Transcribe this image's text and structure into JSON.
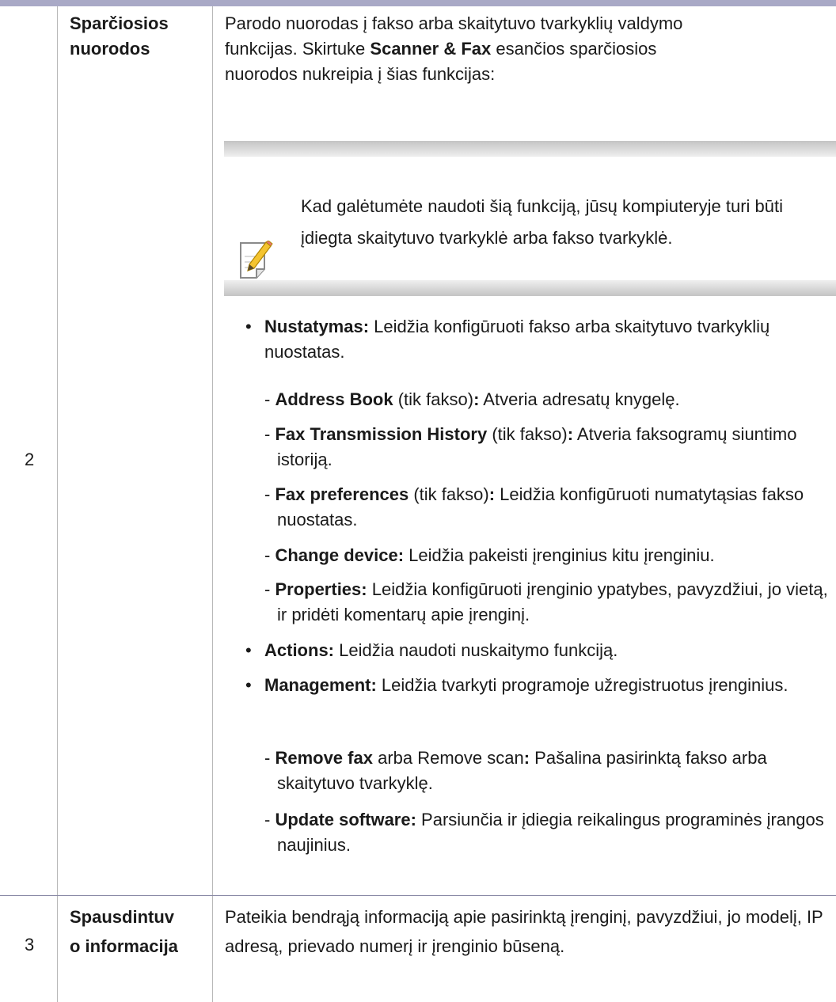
{
  "rows": [
    {
      "number": "2",
      "title_lines": [
        "Sparčiosios",
        "nuorodos"
      ],
      "intro": {
        "line1": "Parodo nuorodas į fakso arba skaitytuvo tvarkyklių valdymo",
        "line2_pre": "funkcijas. Skirtuke ",
        "line2_bold": "Scanner & Fax",
        "line2_post": " esančios sparčiosios",
        "line3": "nuorodos nukreipia į šias funkcijas:"
      },
      "note": {
        "icon": "note-pencil-icon",
        "text": "Kad galėtumėte naudoti šią funkciją, jūsų kompiuteryje turi būti įdiegta skaitytuvo tvarkyklė arba fakso tvarkyklė."
      },
      "bullet_char": "•",
      "items": [
        {
          "label": "Nustatymas:",
          "text": " Leidžia konfigūruoti fakso arba skaitytuvo tvarkyklių nuostatas."
        },
        {
          "label": "Actions:",
          "text": " Leidžia naudoti nuskaitymo funkciją."
        },
        {
          "label": "Management:",
          "text": " Leidžia tvarkyti programoje užregistruotus įrenginius."
        }
      ],
      "setup_subitems": [
        {
          "label": "Address Book",
          "mid": " (tik fakso)",
          "colon": ":",
          "text": " Atveria adresatų knygelę."
        },
        {
          "label": "Fax Transmission History",
          "mid": " (tik fakso)",
          "colon": ":",
          "text": " Atveria faksogramų siuntimo istoriją."
        },
        {
          "label": "Fax preferences",
          "mid": " (tik fakso)",
          "colon": ":",
          "text": " Leidžia konfigūruoti numatytąsias fakso nuostatas."
        },
        {
          "label": "Change device:",
          "mid": "",
          "colon": "",
          "text": " Leidžia pakeisti įrenginius kitu įrenginiu."
        },
        {
          "label": "Properties:",
          "mid": "",
          "colon": "",
          "text": " Leidžia konfigūruoti įrenginio ypatybes, pavyzdžiui, jo vietą, ir pridėti komentarų apie įrenginį."
        }
      ],
      "management_subitems": [
        {
          "label": "Remove fax",
          "mid": " arba Remove scan",
          "colon": ":",
          "text": " Pašalina pasirinktą fakso arba skaitytuvo tvarkyklę."
        },
        {
          "label": "Update software:",
          "mid": "",
          "colon": "",
          "text": " Parsiunčia ir įdiegia reikalingus programinės įrangos naujinius."
        }
      ]
    },
    {
      "number": "3",
      "title_lines": [
        "Spausdintuv",
        "o informacija"
      ],
      "description": "Pateikia bendrąją informaciją apie pasirinktą įrenginį, pavyzdžiui, jo modelį, IP adresą, prievado numerį ir įrenginio būseną."
    }
  ]
}
